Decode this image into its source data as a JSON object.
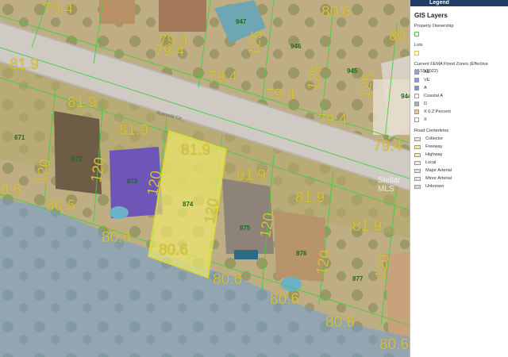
{
  "legend": {
    "header": "Legend",
    "title": "GIS Layers",
    "property_ownership": "Property Ownership",
    "lots": "Lots",
    "flood_title": "Current FEMA Flood Zones (Effective 12/15/2022)",
    "flood_zones": [
      {
        "label": "AE",
        "color": "#8fa1d8"
      },
      {
        "label": "VE",
        "color": "#a18fd8"
      },
      {
        "label": "A",
        "color": "#7a92e0"
      },
      {
        "label": "Coastal A",
        "color": "#ffffff"
      },
      {
        "label": "D",
        "color": "#b7a8c6"
      },
      {
        "label": "X 0.2 Percent",
        "color": "#f0c890"
      },
      {
        "label": "X",
        "color": "#ffffff"
      }
    ],
    "road_title": "Road Centerlines",
    "roads": [
      {
        "label": "Collector",
        "color": "#e6e6e6"
      },
      {
        "label": "Freeway",
        "color": "#f5f08a"
      },
      {
        "label": "Highway",
        "color": "#f7f2a3"
      },
      {
        "label": "Local",
        "color": "#ececec"
      },
      {
        "label": "Major Arterial",
        "color": "#e0e0e0"
      },
      {
        "label": "Minor Arterial",
        "color": "#e4e4e4"
      },
      {
        "label": "Unknown",
        "color": "#dadada"
      }
    ]
  },
  "map": {
    "street_label": "Rotonda Cir",
    "watermark": "Stellar MLS",
    "dimensions": [
      "79.4",
      "79.4",
      "79.4",
      "125",
      "80.6",
      "79.4",
      "79.4",
      "125",
      "80.6",
      "81.9",
      "81.9",
      "81.9",
      "79.4",
      "125",
      "79.4",
      "120",
      "120",
      "80.6",
      "80.6",
      "0.6",
      "81.9",
      "120",
      "120",
      "80.6",
      "80.6",
      "81.9",
      "120",
      "81.9",
      "81.9",
      "120",
      "120",
      "80.6",
      "80.6",
      "80.6"
    ],
    "lot_numbers": [
      "947",
      "946",
      "945",
      "944",
      "871",
      "872",
      "873",
      "874",
      "875",
      "876",
      "877"
    ],
    "highlight_color": "#f4ee6a",
    "flood_color": "#6f9fd6"
  }
}
